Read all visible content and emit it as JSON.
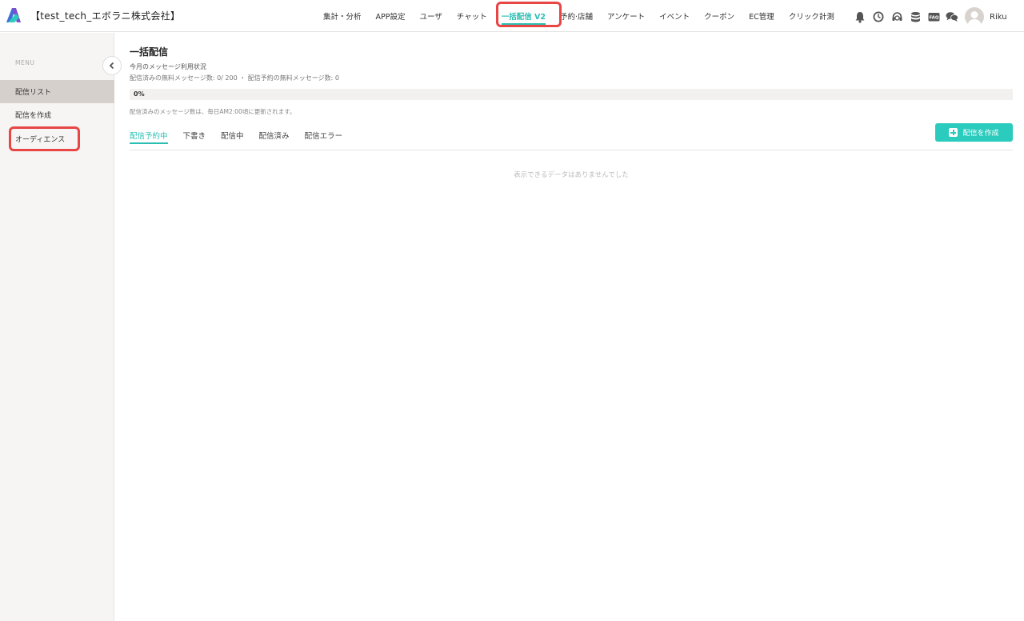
{
  "header": {
    "org_name": "【test_tech_エボラニ株式会社】",
    "nav": [
      {
        "label": "集計・分析"
      },
      {
        "label": "APP設定"
      },
      {
        "label": "ユーザ"
      },
      {
        "label": "チャット"
      },
      {
        "label": "一括配信 V2",
        "active": true
      },
      {
        "label": "予約·店舗"
      },
      {
        "label": "アンケート"
      },
      {
        "label": "イベント"
      },
      {
        "label": "クーポン"
      },
      {
        "label": "EC管理"
      },
      {
        "label": "クリック計測"
      }
    ],
    "icons": [
      "bell-icon",
      "clock-icon",
      "support-headset-icon",
      "database-icon",
      "faq-icon",
      "chat-bubbles-icon"
    ],
    "user_name": "Riku"
  },
  "sidebar": {
    "menu_label": "MENU",
    "items": [
      {
        "label": "配信リスト",
        "active": true
      },
      {
        "label": "配信を作成"
      },
      {
        "label": "オーディエンス"
      }
    ]
  },
  "main": {
    "title": "一括配信",
    "usage_label": "今月のメッセージ利用状況",
    "usage_detail": "配信済みの無料メッセージ数: 0/ 200 ・ 配信予約の無料メッセージ数: 0",
    "progress_percent": 0,
    "progress_text": "0%",
    "update_note": "配信済みのメッセージ数は、毎日AM2:00頃に更新されます。",
    "tabs": [
      {
        "label": "配信予約中",
        "active": true
      },
      {
        "label": "下書き"
      },
      {
        "label": "配信中"
      },
      {
        "label": "配信済み"
      },
      {
        "label": "配信エラー"
      }
    ],
    "create_button": "配信を作成",
    "empty_message": "表示できるデータはありませんでした"
  },
  "colors": {
    "accent": "#2bbfb3",
    "highlight": "#e84545",
    "sidebar_bg": "#f7f5f4",
    "sidebar_active": "#d6d0cc"
  }
}
